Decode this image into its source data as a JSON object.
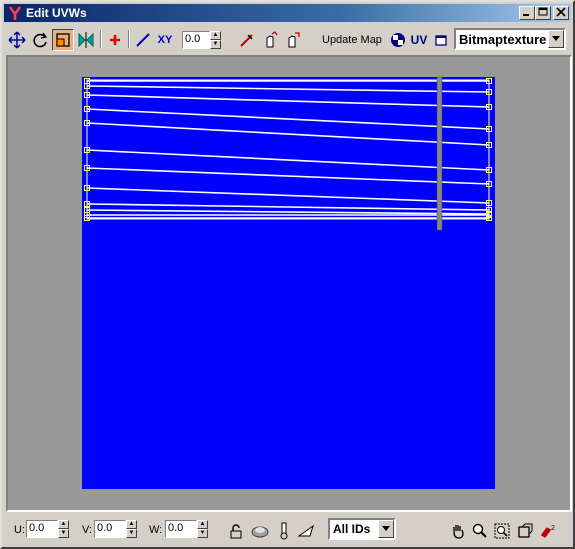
{
  "window": {
    "title": "Edit UVWs"
  },
  "toolbar": {
    "spinner_value": "0.0",
    "xy_label": "XY",
    "update_map_label": "Update Map",
    "uv_label": "UV",
    "texture_dropdown_value": "Bitmaptexture"
  },
  "bottom": {
    "u_label": "U:",
    "u_value": "0.0",
    "v_label": "V:",
    "v_value": "0.0",
    "w_label": "W:",
    "w_value": "0.0",
    "ids_dropdown_value": "All IDs"
  },
  "colors": {
    "uv_background": "#0000ff",
    "viewport_gray": "#999999",
    "uv_lines": "#ffffff",
    "vertex_yellow": "#ffff66"
  },
  "icons": [
    "app-logo-icon",
    "move-icon",
    "rotate-icon",
    "scale-icon",
    "mirror-icon",
    "weld-icon",
    "straighten-icon",
    "pick-icon",
    "break-icon",
    "detach-icon",
    "checker-icon",
    "show-map-icon",
    "pan-hand-icon",
    "zoom-icon",
    "zoom-region-icon",
    "zoom-extents-icon",
    "snap-icon",
    "lock-icon",
    "hide-icon",
    "freeze-icon",
    "filter-icon"
  ]
}
